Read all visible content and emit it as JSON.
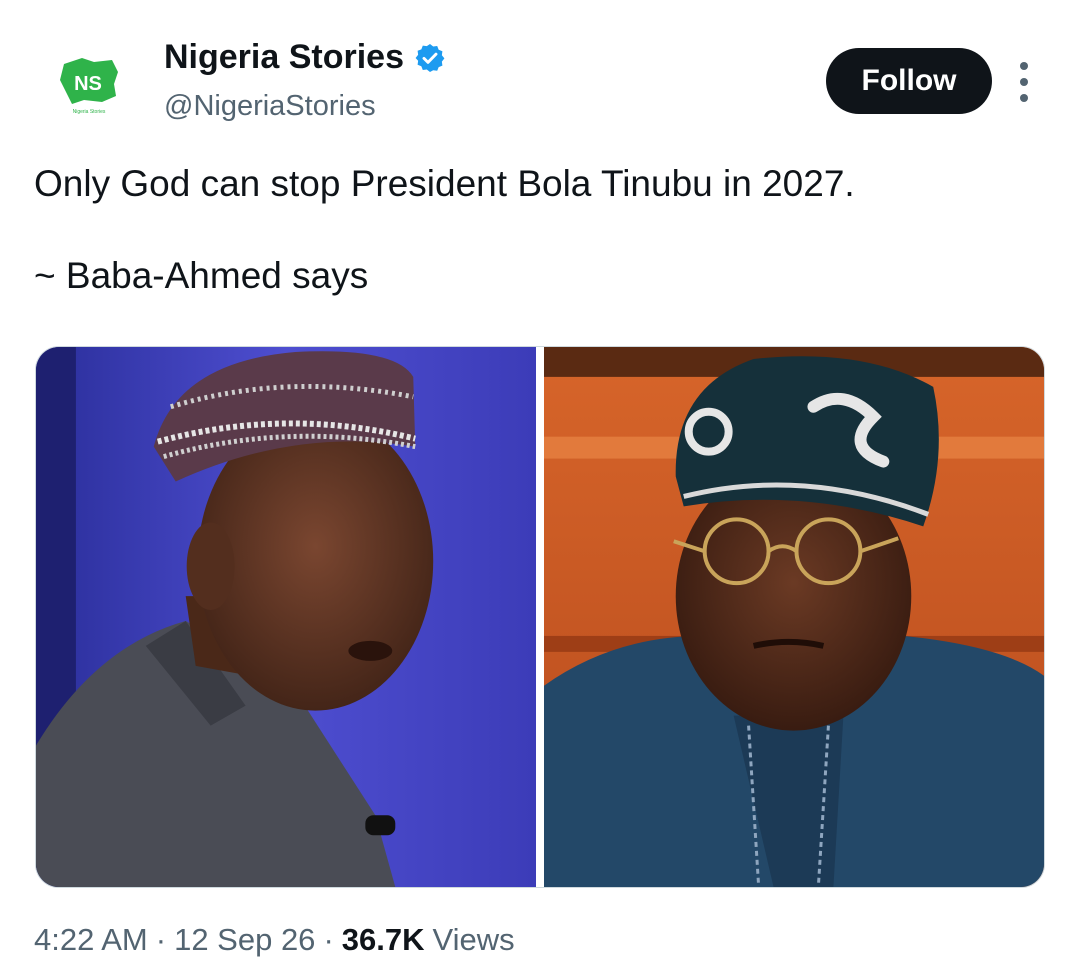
{
  "author": {
    "name": "Nigeria Stories",
    "handle": "@NigeriaStories",
    "verified": true,
    "avatar_icon": "nigeria-map-logo",
    "avatar_text": "NS",
    "avatar_subtext": "Nigeria Stories"
  },
  "actions": {
    "follow_label": "Follow",
    "more_icon": "more-vertical-icon"
  },
  "tweet": {
    "line1": "Only God can stop President Bola Tinubu in 2027.",
    "line2": "~ Baba-Ahmed says"
  },
  "media": {
    "count": 2
  },
  "meta": {
    "time": "4:22 AM",
    "separator": "·",
    "date": "12 Sep 26",
    "views_count": "36.7K",
    "views_label": "Views"
  },
  "colors": {
    "text_primary": "#0f1419",
    "text_secondary": "#536471",
    "verified_blue": "#1d9bf0",
    "logo_green": "#2fb34a",
    "follow_bg": "#0f1419"
  }
}
